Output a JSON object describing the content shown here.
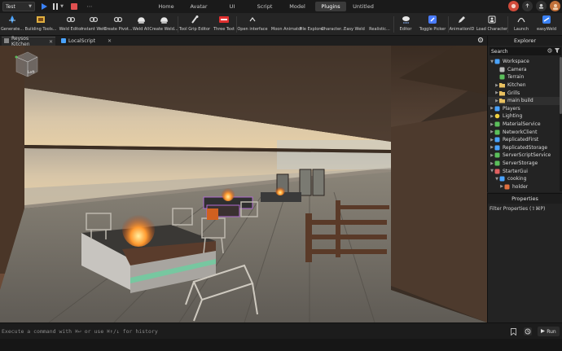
{
  "menubar": {
    "mode": "Test",
    "tabs": [
      "Home",
      "Avatar",
      "UI",
      "Script",
      "Model",
      "Plugins",
      "Untitled"
    ],
    "active_tab": "Plugins",
    "avatar_initial": "",
    "colors": {
      "accent": "#3b82f6",
      "stop": "#e05050"
    }
  },
  "ribbon": {
    "tools": [
      {
        "label": "Generate...",
        "icon": "generate-icon",
        "color": "#4aa3ff"
      },
      {
        "label": "Building Tools...",
        "icon": "building-tools-icon",
        "color": "#e0b040"
      },
      {
        "label": "Weld Editor",
        "icon": "weld-editor-icon",
        "color": "#bbbbbb"
      },
      {
        "label": "Instant Weld",
        "icon": "instant-weld-icon",
        "color": "#bbbbbb"
      },
      {
        "label": "Create Pivot...",
        "icon": "create-pivot-icon",
        "color": "#bbbbbb"
      },
      {
        "label": "Weld All",
        "icon": "weld-all-icon",
        "color": "#dddddd"
      },
      {
        "label": "Create Weld...",
        "icon": "create-weld-icon",
        "color": "#dddddd"
      },
      {
        "label": "Tool Grip Editor",
        "icon": "tool-grip-icon",
        "color": "#dddddd"
      },
      {
        "label": "Three Text",
        "icon": "three-text-icon",
        "color": "#e03030"
      },
      {
        "label": "Open interface",
        "icon": "chevron-up-icon",
        "color": "#dddddd"
      },
      {
        "label": "Moon Animator",
        "icon": "",
        "color": ""
      },
      {
        "label": "File Explorer",
        "icon": "",
        "color": ""
      },
      {
        "label": "Character...",
        "icon": "",
        "color": ""
      },
      {
        "label": "Easy Weld",
        "icon": "",
        "color": ""
      },
      {
        "label": "Realistic...",
        "icon": "",
        "color": ""
      },
      {
        "label": "Editor",
        "icon": "weather-icon",
        "color": "#dddddd"
      },
      {
        "label": "Toggle Picker",
        "icon": "picker-icon",
        "color": "#4a7cff"
      },
      {
        "label": "AnimationID",
        "icon": "pencil-icon",
        "color": "#dddddd"
      },
      {
        "label": "Load Character",
        "icon": "load-character-icon",
        "color": "#dddddd"
      },
      {
        "label": "Launch",
        "icon": "launch-icon",
        "color": "#dddddd"
      },
      {
        "label": "easyWeld",
        "icon": "easyweld-icon",
        "color": "#3b82f6"
      }
    ]
  },
  "doc_tabs": [
    {
      "label": "Reysos Kitchen",
      "icon": "place-icon"
    },
    {
      "label": "LocalScript",
      "icon": "script-icon"
    }
  ],
  "viewport": {
    "camera_label": "Left"
  },
  "explorer": {
    "title": "Explorer",
    "search_value": "Search",
    "items": [
      {
        "label": "Workspace",
        "depth": 0,
        "expanded": true,
        "icon": "workspace-icon",
        "color": "#4aa3ff"
      },
      {
        "label": "Camera",
        "depth": 1,
        "expanded": null,
        "icon": "camera-icon",
        "color": "#bbbbbb"
      },
      {
        "label": "Terrain",
        "depth": 1,
        "expanded": null,
        "icon": "terrain-icon",
        "color": "#5bbf5b"
      },
      {
        "label": "Kitchen",
        "depth": 1,
        "expanded": false,
        "icon": "folder-icon",
        "color": "#e8c060"
      },
      {
        "label": "Grills",
        "depth": 1,
        "expanded": false,
        "icon": "folder-icon",
        "color": "#e8c060"
      },
      {
        "label": "main build",
        "depth": 1,
        "expanded": false,
        "icon": "folder-icon",
        "color": "#e8c060"
      },
      {
        "label": "Players",
        "depth": 0,
        "expanded": false,
        "icon": "players-icon",
        "color": "#4aa3ff"
      },
      {
        "label": "Lighting",
        "depth": 0,
        "expanded": false,
        "icon": "lighting-icon",
        "color": "#f0d040"
      },
      {
        "label": "MaterialService",
        "depth": 0,
        "expanded": false,
        "icon": "material-icon",
        "color": "#5bbf5b"
      },
      {
        "label": "NetworkClient",
        "depth": 0,
        "expanded": false,
        "icon": "network-icon",
        "color": "#5bbf5b"
      },
      {
        "label": "ReplicatedFirst",
        "depth": 0,
        "expanded": false,
        "icon": "replicated-first-icon",
        "color": "#4aa3ff"
      },
      {
        "label": "ReplicatedStorage",
        "depth": 0,
        "expanded": false,
        "icon": "replicated-storage-icon",
        "color": "#4aa3ff"
      },
      {
        "label": "ServerScriptService",
        "depth": 0,
        "expanded": false,
        "icon": "server-script-icon",
        "color": "#5bbf5b"
      },
      {
        "label": "ServerStorage",
        "depth": 0,
        "expanded": false,
        "icon": "server-storage-icon",
        "color": "#5bbf5b"
      },
      {
        "label": "StarterGui",
        "depth": 0,
        "expanded": true,
        "icon": "starter-gui-icon",
        "color": "#e06060"
      },
      {
        "label": "cooking",
        "depth": 1,
        "expanded": true,
        "icon": "screen-gui-icon",
        "color": "#4aa3ff"
      },
      {
        "label": "holder",
        "depth": 2,
        "expanded": false,
        "icon": "frame-icon",
        "color": "#e07040"
      }
    ],
    "selected_index": 5
  },
  "properties": {
    "title": "Properties",
    "filter_label": "Filter Properties (⇧⌘P)"
  },
  "command_bar": {
    "placeholder": "Execute a command with ⌘↩ or use ⌘↑/↓ for history",
    "run_label": "Run"
  }
}
